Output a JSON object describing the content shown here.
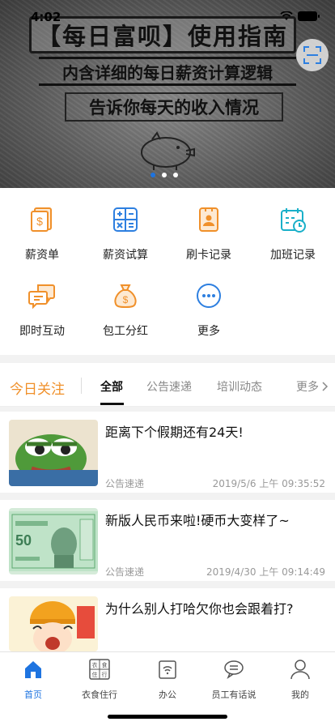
{
  "status": {
    "time": "4:02"
  },
  "banner": {
    "title": "【每日富呗】使用指南",
    "line1": "内含详细的每日薪资计算逻辑",
    "line2": "告诉你每天的收入情况",
    "page_count": 3,
    "active_page": 1
  },
  "menu": {
    "items": [
      {
        "label": "薪资单",
        "icon": "payslip-icon"
      },
      {
        "label": "薪资试算",
        "icon": "calculator-icon"
      },
      {
        "label": "刷卡记录",
        "icon": "card-record-icon"
      },
      {
        "label": "加班记录",
        "icon": "overtime-calendar-icon"
      },
      {
        "label": "即时互动",
        "icon": "chat-icon"
      },
      {
        "label": "包工分红",
        "icon": "money-bag-icon"
      },
      {
        "label": "更多",
        "icon": "more-icon"
      }
    ]
  },
  "tabs": {
    "today": "今日关注",
    "items": [
      "全部",
      "公告速递",
      "培训动态"
    ],
    "active": "全部",
    "more": "更多"
  },
  "news": [
    {
      "title": "距离下个假期还有24天!",
      "category": "公告速递",
      "date": "2019/5/6 上午 09:35:52",
      "thumb": "frog-image"
    },
    {
      "title": "新版人民币来啦!硬币大变样了~",
      "category": "公告速递",
      "date": "2019/4/30 上午 09:14:49",
      "thumb": "banknote-image"
    },
    {
      "title": "为什么别人打哈欠你也会跟着打?",
      "category": "",
      "date": "",
      "thumb": "cartoon-girl-image"
    }
  ],
  "tabbar": {
    "items": [
      {
        "label": "首页",
        "icon": "home-icon"
      },
      {
        "label": "衣食住行",
        "icon": "lifestyle-icon"
      },
      {
        "label": "办公",
        "icon": "office-icon"
      },
      {
        "label": "员工有话说",
        "icon": "speech-icon"
      },
      {
        "label": "我的",
        "icon": "profile-icon"
      }
    ],
    "active": "首页"
  },
  "colors": {
    "accent": "#1e74e0",
    "orange": "#f0902a"
  }
}
